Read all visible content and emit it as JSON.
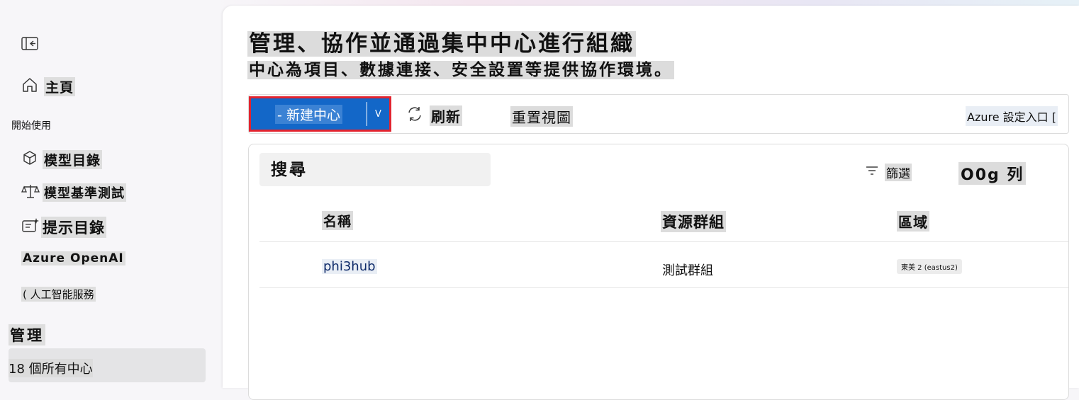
{
  "sidebar": {
    "collapse_icon": "collapse-sidebar-icon",
    "home": {
      "icon": "home-icon",
      "label": "主頁"
    },
    "section_get_started": "開始使用",
    "items": [
      {
        "icon": "cube-icon",
        "label": "模型目錄"
      },
      {
        "icon": "scale-icon",
        "label": "模型基準測試"
      },
      {
        "icon": "prompt-sparkle-icon",
        "label": "提示目錄"
      },
      {
        "icon": "openai-icon",
        "label": "Azure OpenAI"
      },
      {
        "icon": "",
        "label": "( 人工智能服務"
      }
    ],
    "section_manage": "管理",
    "active_item": "18 個所有中心"
  },
  "header": {
    "title": "管理、協作並通過集中中心進行組織",
    "subtitle": "中心為項目、數據連接、安全設置等提供協作環境。"
  },
  "toolbar": {
    "new_hub_label": "- 新建中心",
    "new_hub_dropdown": "V",
    "refresh_label": "刷新",
    "reset_view_label": "重置視圖",
    "azure_portal_label": "Azure 設定入口 ["
  },
  "grid": {
    "search_placeholder": "搜尋",
    "filter_label": "篩選",
    "columns_label": "O0g 列",
    "headers": [
      "名稱",
      "資源群組",
      "區域"
    ],
    "rows": [
      {
        "name": "phi3hub",
        "resource_group": "測試群組",
        "region": "東美 2 (eastus2)"
      }
    ]
  },
  "colors": {
    "primary_button": "#1367c8",
    "highlight_border": "#e2242f"
  }
}
